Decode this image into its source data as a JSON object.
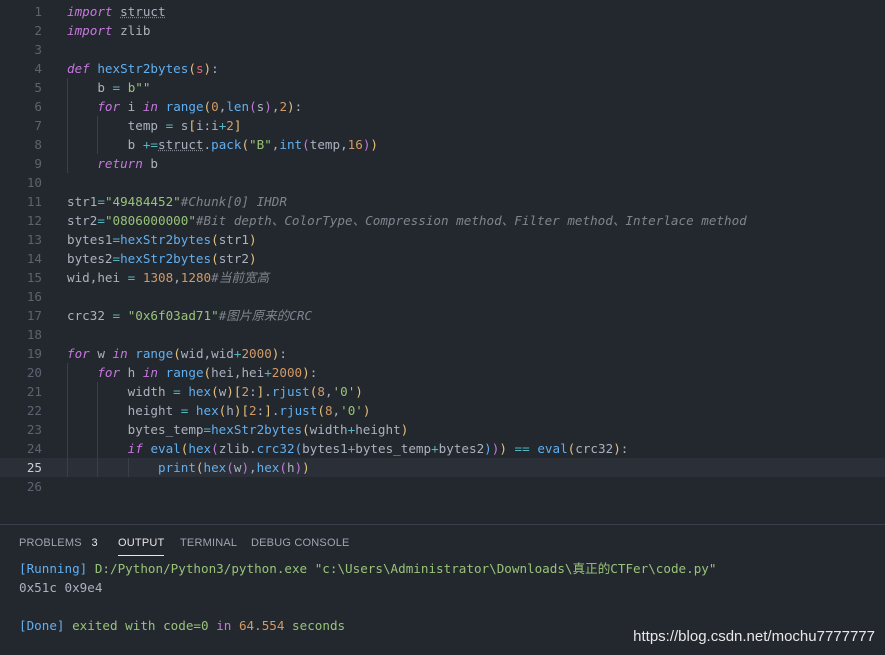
{
  "editor": {
    "line_numbers": [
      "1",
      "2",
      "3",
      "4",
      "5",
      "6",
      "7",
      "8",
      "9",
      "10",
      "11",
      "12",
      "13",
      "14",
      "15",
      "16",
      "17",
      "18",
      "19",
      "20",
      "21",
      "22",
      "23",
      "24",
      "25",
      "26"
    ],
    "lines": [
      "import struct",
      "import zlib",
      "",
      "def hexStr2bytes(s):",
      "    b = b\"\"",
      "    for i in range(0,len(s),2):",
      "        temp = s[i:i+2]",
      "        b +=struct.pack(\"B\",int(temp,16))",
      "    return b",
      "",
      "str1=\"49484452\"#Chunk[0] IHDR",
      "str2=\"0806000000\"#Bit depth、ColorType、Compression method、Filter method、Interlace method",
      "bytes1=hexStr2bytes(str1)",
      "bytes2=hexStr2bytes(str2)",
      "wid,hei = 1308,1280#当前宽高",
      "",
      "crc32 = \"0x6f03ad71\"#图片原来的CRC",
      "",
      "for w in range(wid,wid+2000):",
      "    for h in range(hei,hei+2000):",
      "        width = hex(w)[2:].rjust(8,'0')",
      "        height = hex(h)[2:].rjust(8,'0')",
      "        bytes_temp=hexStr2bytes(width+height)",
      "        if eval(hex(zlib.crc32(bytes1+bytes_temp+bytes2))) == eval(crc32):",
      "            print(hex(w),hex(h))",
      ""
    ],
    "current_line": "25"
  },
  "panel": {
    "tabs": {
      "problems": "PROBLEMS",
      "problems_count": "3",
      "output": "OUTPUT",
      "terminal": "TERMINAL",
      "debug": "DEBUG CONSOLE"
    },
    "output": {
      "running_tag": "[Running]",
      "running_cmd": "D:/Python/Python3/python.exe \"c:\\Users\\Administrator\\Downloads\\真正的CTFer\\code.py\"",
      "result": "0x51c 0x9e4",
      "done_tag": "[Done]",
      "exited_with": "exited with",
      "code_label": "code=0",
      "in": "in",
      "seconds_value": "64.554",
      "seconds_label": "seconds"
    }
  },
  "watermark": "https://blog.csdn.net/mochu7777777",
  "colors": {
    "background": "#23272e",
    "keyword": "#c678dd",
    "function": "#61afef",
    "string": "#98c379",
    "number": "#d19a66",
    "comment": "#7f848e"
  }
}
